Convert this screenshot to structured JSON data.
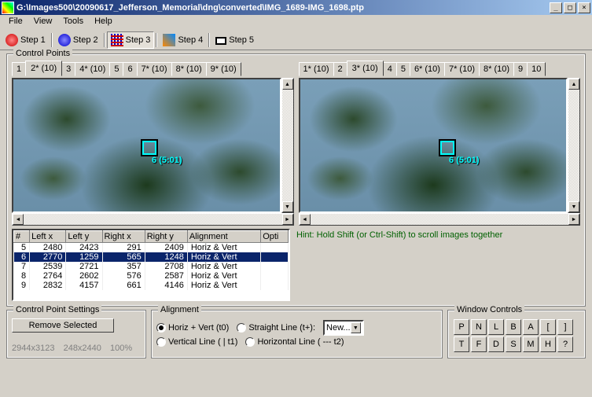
{
  "window": {
    "title": "G:\\Images500\\20090617_Jefferson_Memorial\\dng\\converted\\IMG_1689-IMG_1698.ptp"
  },
  "menu": {
    "file": "File",
    "view": "View",
    "tools": "Tools",
    "help": "Help"
  },
  "steps": {
    "s1": "Step 1",
    "s2": "Step 2",
    "s3": "Step 3",
    "s4": "Step 4",
    "s5": "Step 5"
  },
  "cp": {
    "legend": "Control Points"
  },
  "tabs_left": [
    "1",
    "2* (10)",
    "3",
    "4* (10)",
    "5",
    "6",
    "7* (10)",
    "8* (10)",
    "9* (10)"
  ],
  "tabs_right": [
    "1* (10)",
    "2",
    "3* (10)",
    "4",
    "5",
    "6* (10)",
    "7* (10)",
    "8* (10)",
    "9",
    "10"
  ],
  "tabs_sel_left": 1,
  "tabs_sel_right": 2,
  "cplabel_left": "6 (5:01)",
  "cplabel_right": "6 (5:01)",
  "table": {
    "headers": [
      "#",
      "Left x",
      "Left y",
      "Right x",
      "Right y",
      "Alignment",
      "Opti"
    ],
    "rows": [
      {
        "n": "5",
        "lx": "2480",
        "ly": "2423",
        "rx": "291",
        "ry": "2409",
        "al": "Horiz & Vert"
      },
      {
        "n": "6",
        "lx": "2770",
        "ly": "1259",
        "rx": "565",
        "ry": "1248",
        "al": "Horiz & Vert"
      },
      {
        "n": "7",
        "lx": "2539",
        "ly": "2721",
        "rx": "357",
        "ry": "2708",
        "al": "Horiz & Vert"
      },
      {
        "n": "8",
        "lx": "2764",
        "ly": "2602",
        "rx": "576",
        "ry": "2587",
        "al": "Horiz & Vert"
      },
      {
        "n": "9",
        "lx": "2832",
        "ly": "4157",
        "rx": "661",
        "ry": "4146",
        "al": "Horiz & Vert"
      }
    ],
    "sel": 1
  },
  "hint": "Hint: Hold Shift (or Ctrl-Shift) to scroll images together",
  "cps": {
    "legend": "Control Point Settings",
    "remove": "Remove Selected",
    "info1": "2944x3123",
    "info2": "248x2440",
    "info3": "100%"
  },
  "align": {
    "legend": "Alignment",
    "hv": "Horiz + Vert (t0)",
    "sl": "Straight Line (t+):",
    "vl": "Vertical Line ( | t1)",
    "hl": "Horizontal Line ( --- t2)",
    "combo": "New..."
  },
  "wc": {
    "legend": "Window Controls",
    "b": [
      "P",
      "N",
      "L",
      "B",
      "A",
      "[",
      "]",
      "T",
      "F",
      "D",
      "S",
      "M",
      "H",
      "?"
    ]
  }
}
